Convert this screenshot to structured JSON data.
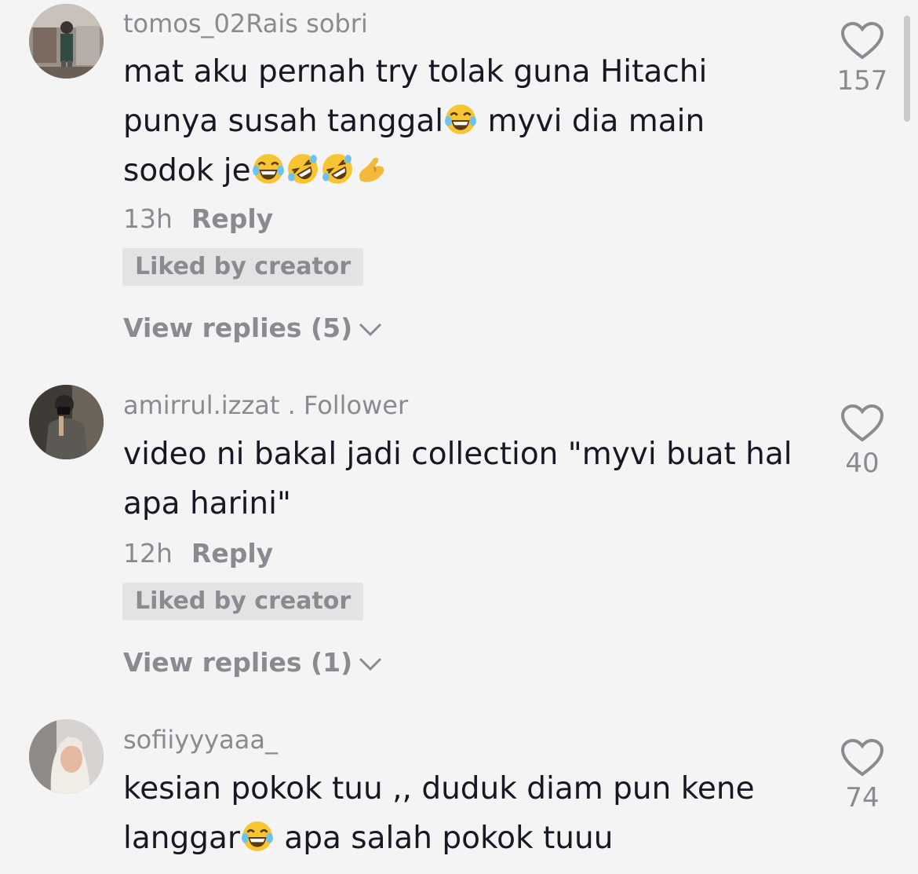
{
  "comments": [
    {
      "username": "tomos_02Rais sobri",
      "lines": [
        "mat aku pernah try tolak guna Hitachi",
        "punya susah tanggal",
        " myvi dia main",
        "sodok je"
      ],
      "time": "13h",
      "reply_label": "Reply",
      "badge": "Liked by creator",
      "view_replies": "View replies (5)",
      "likes": "157"
    },
    {
      "username": "amirrul.izzat . Follower",
      "lines": [
        "video ni bakal jadi collection \"myvi buat hal",
        "apa harini\""
      ],
      "time": "12h",
      "reply_label": "Reply",
      "badge": "Liked by creator",
      "view_replies": "View replies (1)",
      "likes": "40"
    },
    {
      "username": "sofiiyyyaaa_",
      "lines": [
        "kesian pokok tuu ,, duduk diam pun kene",
        "langgar",
        " apa salah pokok tuuu"
      ],
      "likes": "74"
    }
  ],
  "icons": {
    "like": "heart-outline-icon",
    "laugh": "face-with-tears-of-joy-emoji",
    "rofl": "rolling-on-floor-laughing-emoji",
    "pinch": "pinching-hand-emoji",
    "chevron": "chevron-down-icon"
  },
  "colors": {
    "background": "#f4f4f4",
    "text": "#161823",
    "muted": "#8a8b91",
    "badge_bg": "#e3e3e4"
  }
}
